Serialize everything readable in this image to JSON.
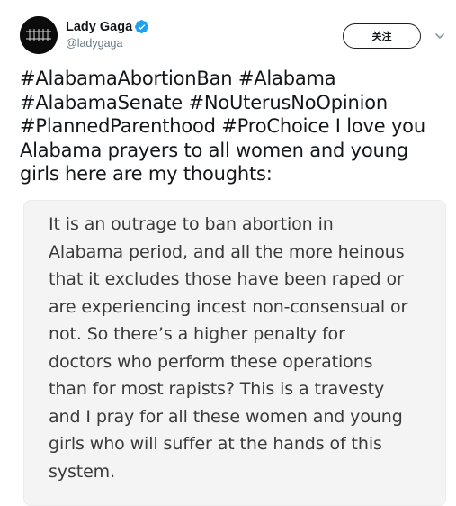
{
  "tweet": {
    "author": {
      "display_name": "Lady Gaga",
      "handle": "@ladygaga",
      "verified": true,
      "avatar_icon": "avatar-image"
    },
    "follow_label": "关注",
    "caret_icon": "chevron-down-icon",
    "text_lines": [
      "#AlabamaAbortionBan #Alabama",
      "#AlabamaSenate #NoUterusNoOpinion",
      "#PlannedParenthood #ProChoice I love you",
      "Alabama prayers to all women and young",
      "girls here are my thoughts:"
    ]
  },
  "note": {
    "lines": [
      "It is an outrage to ban abortion in",
      "Alabama period, and all the more heinous",
      "that it excludes those have been raped or",
      "are experiencing incest non-consensual or",
      "not. So there’s a higher penalty for",
      "doctors who perform these operations",
      "than for most rapists? This is a travesty",
      "and I pray for all these women and young",
      "girls who will suffer at the hands of this",
      "system."
    ]
  },
  "colors": {
    "verified_blue": "#1da1f2",
    "handle_gray": "#657786",
    "note_background": "#f4f4f4",
    "note_text": "#3a3a3a"
  }
}
